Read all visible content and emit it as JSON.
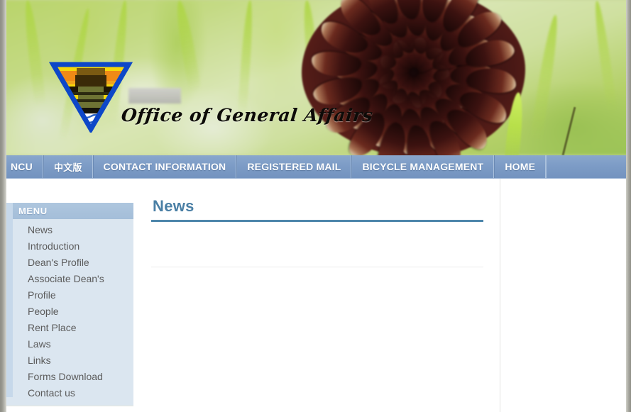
{
  "banner": {
    "logo_name": "ncu-general-affairs-triangle-logo",
    "redacted_label": "",
    "brand_part1": "Office of",
    "brand_part2": "General Affairs",
    "photo_subject": "pine-cone-on-grass"
  },
  "navbar": {
    "items": [
      {
        "label": "NCU",
        "cjk": false
      },
      {
        "label": "中文版",
        "cjk": true
      },
      {
        "label": "CONTACT INFORMATION",
        "cjk": false
      },
      {
        "label": "REGISTERED MAIL",
        "cjk": false
      },
      {
        "label": "BICYCLE MANAGEMENT",
        "cjk": false
      },
      {
        "label": "HOME",
        "cjk": false
      }
    ]
  },
  "sidebar": {
    "header": "MENU",
    "items": [
      {
        "label": "News"
      },
      {
        "label": "Introduction"
      },
      {
        "label": "Dean's Profile"
      },
      {
        "label": "Associate Dean's"
      },
      {
        "label": "Profile"
      },
      {
        "label": "People"
      },
      {
        "label": "Rent Place"
      },
      {
        "label": "Laws"
      },
      {
        "label": "Links"
      },
      {
        "label": "Forms Download"
      },
      {
        "label": "Contact us"
      }
    ]
  },
  "main": {
    "title": "News",
    "body_text": ""
  },
  "colors": {
    "nav_blue": "#7d9cc6",
    "menu_header_blue": "#a4bed9",
    "menu_panel_blue": "#dbe6f0",
    "title_blue": "#4a7fa5",
    "rule_blue": "#4d86ab",
    "menu_text_gray": "#5b5b5b"
  }
}
